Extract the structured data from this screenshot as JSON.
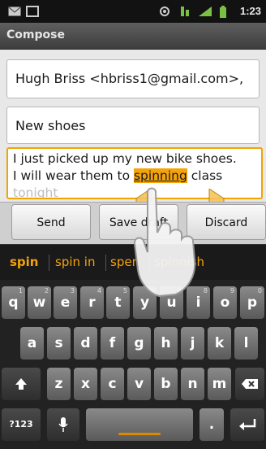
{
  "status_bar": {
    "time": "1:23"
  },
  "title_bar": {
    "title": "Compose"
  },
  "compose": {
    "to_value": "Hugh Briss <hbriss1@gmail.com>,",
    "subject_value": "New shoes",
    "body": {
      "line1": "I just picked up my new bike shoes.",
      "line2_before": "I will wear them to ",
      "line2_selected": "spinning",
      "line2_after": " class",
      "line3_partial": "tonight"
    }
  },
  "buttons": {
    "send": "Send",
    "save_draft": "Save draft",
    "discard": "Discard"
  },
  "suggestions": [
    "spin",
    "spin in",
    "spen",
    "spinnish"
  ],
  "keyboard": {
    "row1": [
      {
        "k": "q",
        "n": "1"
      },
      {
        "k": "w",
        "n": "2"
      },
      {
        "k": "e",
        "n": "3"
      },
      {
        "k": "r",
        "n": "4"
      },
      {
        "k": "t",
        "n": "5"
      },
      {
        "k": "y",
        "n": "6"
      },
      {
        "k": "u",
        "n": "7"
      },
      {
        "k": "i",
        "n": "8"
      },
      {
        "k": "o",
        "n": "9"
      },
      {
        "k": "p",
        "n": "0"
      }
    ],
    "row2": [
      "a",
      "s",
      "d",
      "f",
      "g",
      "h",
      "j",
      "k",
      "l"
    ],
    "row3": [
      "z",
      "x",
      "c",
      "v",
      "b",
      "n",
      "m"
    ],
    "sym_label": "?123",
    "period": "."
  },
  "colors": {
    "selection": "#f5a30a",
    "accent": "#f0a500"
  }
}
